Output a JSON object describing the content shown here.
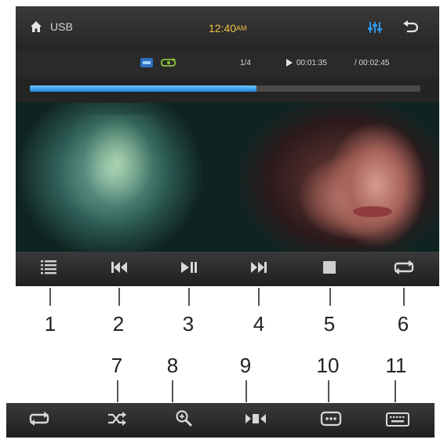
{
  "topbar": {
    "source": "USB",
    "time": "12:40",
    "ampm": "AM"
  },
  "infobar": {
    "track": "1/4",
    "elapsed": "00:01:35",
    "total": "/ 00:02:45"
  },
  "progress": {
    "fraction": 0.58
  },
  "colors": {
    "accent": "#2e97e8",
    "bar": "#2a2a2a"
  },
  "controls": [
    {
      "icon": "list-icon",
      "callout": "1"
    },
    {
      "icon": "previous-icon",
      "callout": "2"
    },
    {
      "icon": "play-pause-icon",
      "callout": "3"
    },
    {
      "icon": "next-icon",
      "callout": "4"
    },
    {
      "icon": "stop-icon",
      "callout": "5"
    },
    {
      "icon": "repeat-icon",
      "callout": "6"
    }
  ],
  "bottom_controls": [
    {
      "icon": "repeat-icon",
      "callout": ""
    },
    {
      "icon": "shuffle-icon",
      "callout": "7"
    },
    {
      "icon": "zoom-icon",
      "callout": "8"
    },
    {
      "icon": "aspect-ratio-icon",
      "callout": "9"
    },
    {
      "icon": "subtitle-icon",
      "callout": "10"
    },
    {
      "icon": "keyboard-icon",
      "callout": "11"
    }
  ]
}
